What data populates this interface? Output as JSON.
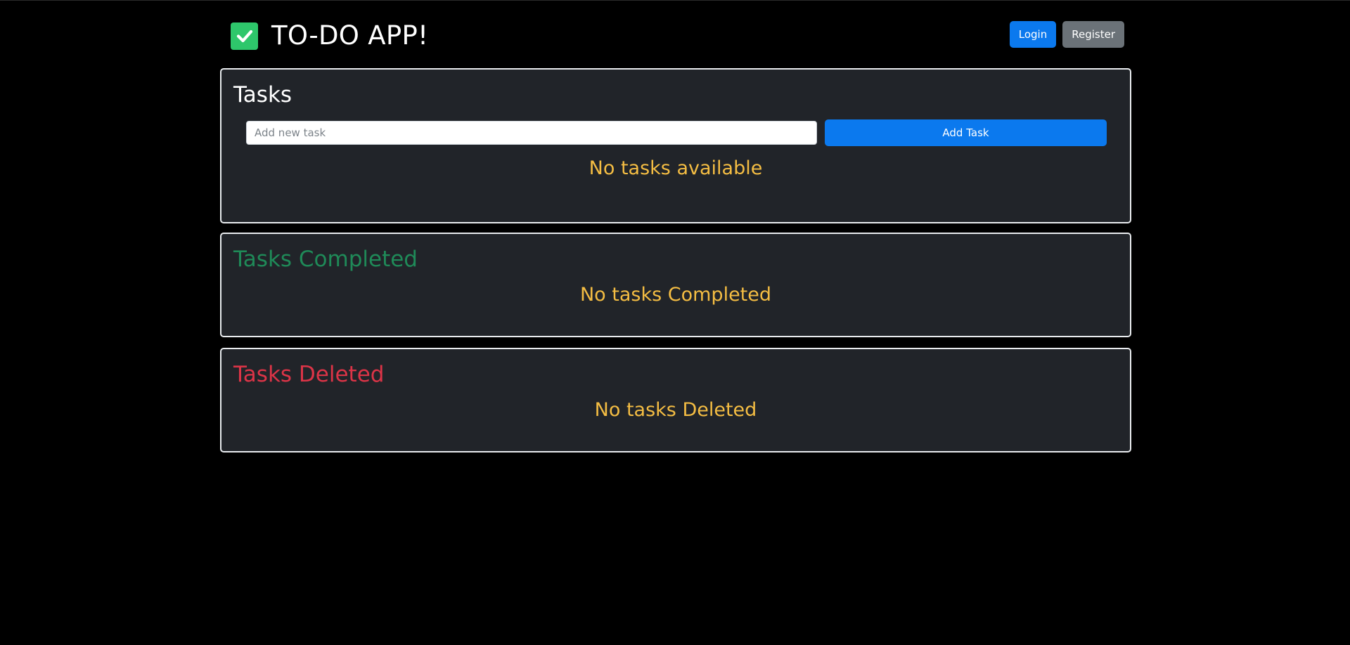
{
  "app": {
    "title": "TO-DO APP!",
    "brand_icon": "check-square-icon",
    "accent_color": "#2ec76b"
  },
  "auth": {
    "login_label": "Login",
    "register_label": "Register"
  },
  "tasks": {
    "heading": "Tasks",
    "input_placeholder": "Add new task",
    "input_value": "",
    "add_button_label": "Add Task",
    "empty_message": "No tasks available"
  },
  "completed": {
    "heading": "Tasks Completed",
    "heading_color": "#1f8a58",
    "empty_message": "No tasks Completed"
  },
  "deleted": {
    "heading": "Tasks Deleted",
    "heading_color": "#dc3447",
    "empty_message": "No tasks Deleted"
  },
  "colors": {
    "primary_button": "#0b79ee",
    "secondary_button": "#6b7278",
    "empty_message": "#f4bd43",
    "card_background": "#212429"
  }
}
